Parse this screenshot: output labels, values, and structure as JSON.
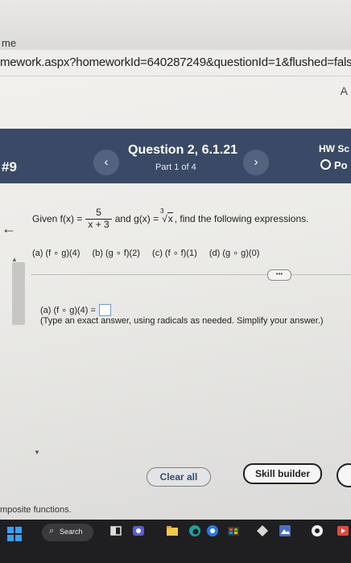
{
  "browser": {
    "tab_text": "me",
    "url": "mework.aspx?homeworkId=640287249&questionId=1&flushed=false&",
    "ext_letter": "A"
  },
  "header": {
    "question_number": "#9",
    "prev_symbol": "‹",
    "next_symbol": "›",
    "title": "Question 2, 6.1.21",
    "part": "Part 1 of 4",
    "hw_score_label": "HW Sc",
    "points_label": "Po"
  },
  "question": {
    "given_prefix": "Given f(x) =",
    "f_numerator": "5",
    "f_denominator": "x + 3",
    "g_middle": "and g(x) =",
    "g_root_index": "3",
    "g_radicand": "x",
    "given_suffix": ", find the following expressions.",
    "parts": [
      "(a)  (f ∘ g)(4)",
      "(b)  (g ∘ f)(2)",
      "(c)  (f ∘ f)(1)",
      "(d)  (g ∘ g)(0)"
    ],
    "more_label": "•••",
    "answer_label": "(a) (f ∘ g)(4) =",
    "instruction": "(Type an exact answer, using radicals as needed. Simplify your answer.)"
  },
  "buttons": {
    "clear_all": "Clear all",
    "skill_builder": "Skill builder"
  },
  "status": {
    "text": "mposite functions."
  },
  "taskbar": {
    "search_label": "Search"
  }
}
